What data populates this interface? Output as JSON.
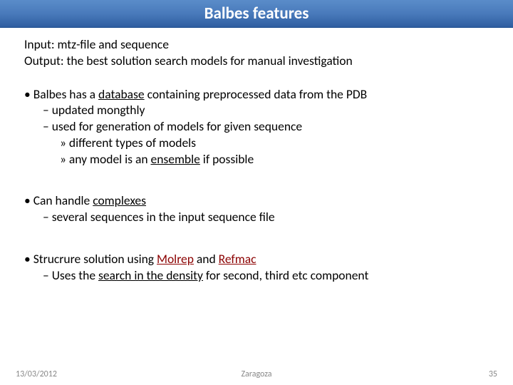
{
  "title": "Balbes features",
  "intro": {
    "l1": "Input: mtz-file and sequence",
    "l2": "Output: the best solution search models for manual investigation"
  },
  "b1": {
    "p": "Balbes has a ",
    "pu": "database",
    "p2": " containing preprocessed data from the PDB",
    "d1": "updated mongthly",
    "d2": "used for generation of models for given sequence",
    "s1": "different types of models",
    "s2p": "any model is an ",
    "s2u": "ensemble",
    "s2p2": " if possible"
  },
  "b2": {
    "p": "Can handle ",
    "pu": "complexes",
    "d1": "several sequences in the input sequence file"
  },
  "b3": {
    "p": "Strucrure solution using ",
    "m1": "Molrep",
    "and": " and ",
    "m2": "Refmac",
    "d1p": "Uses the ",
    "d1u": "search in the density",
    "d1p2": " for second, third etc component"
  },
  "foot": {
    "date": "13/03/2012",
    "venue": "Zaragoza",
    "num": "35"
  }
}
